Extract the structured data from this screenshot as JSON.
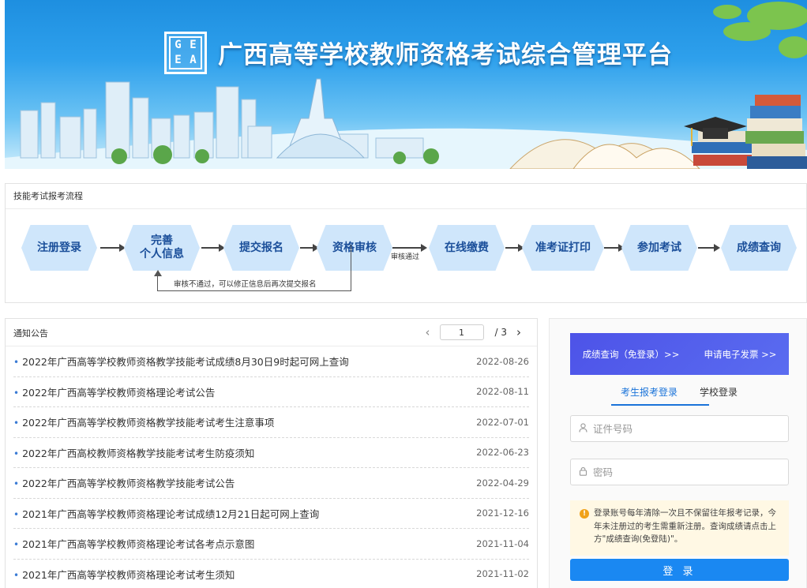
{
  "banner": {
    "logo_letters": [
      "G",
      "E",
      "E",
      "A"
    ],
    "title": "广西高等学校教师资格考试综合管理平台"
  },
  "process": {
    "title": "技能考试报考流程",
    "steps": [
      {
        "label": "注册登录"
      },
      {
        "label": "完善\n个人信息"
      },
      {
        "label": "提交报名"
      },
      {
        "label": "资格审核"
      },
      {
        "label": "在线缴费"
      },
      {
        "label": "准考证打印"
      },
      {
        "label": "参加考试"
      },
      {
        "label": "成绩查询"
      }
    ],
    "approved_note": "审核通过",
    "rejected_note": "审核不通过，可以修正信息后再次提交报名"
  },
  "notices": {
    "title": "通知公告",
    "current_page": "1",
    "total_pages": "/ 3",
    "items": [
      {
        "text": "2022年广西高等学校教师资格教学技能考试成绩8月30日9时起可网上查询",
        "date": "2022-08-26"
      },
      {
        "text": "2022年广西高等学校教师资格理论考试公告",
        "date": "2022-08-11"
      },
      {
        "text": "2022年广西高等学校教师资格教学技能考试考生注意事项",
        "date": "2022-07-01"
      },
      {
        "text": "2022年广西高校教师资格教学技能考试考生防疫须知",
        "date": "2022-06-23"
      },
      {
        "text": "2022年广西高等学校教师资格教学技能考试公告",
        "date": "2022-04-29"
      },
      {
        "text": "2021年广西高等学校教师资格理论考试成绩12月21日起可网上查询",
        "date": "2021-12-16"
      },
      {
        "text": "2021年广西高等学校教师资格理论考试各考点示意图",
        "date": "2021-11-04"
      },
      {
        "text": "2021年广西高等学校教师资格理论考试考生须知",
        "date": "2021-11-02"
      }
    ]
  },
  "login": {
    "score_query": "成绩查询（免登录）>>",
    "invoice": "申请电子发票 >>",
    "tab_candidate": "考生报考登录",
    "tab_school": "学校登录",
    "id_placeholder": "证件号码",
    "password_placeholder": "密码",
    "warning_text": "登录账号每年清除一次且不保留往年报考记录，今年未注册过的考生需重新注册。查询成绩请点击上方\"成绩查询(免登陆)\"。",
    "login_button": "登 录"
  },
  "colors": {
    "step_fill": "#cfe6fb",
    "step_text": "#1b4f9a",
    "primary": "#1a88f2",
    "banner_purple": "#4d53e8",
    "warning": "#f0a21a"
  }
}
